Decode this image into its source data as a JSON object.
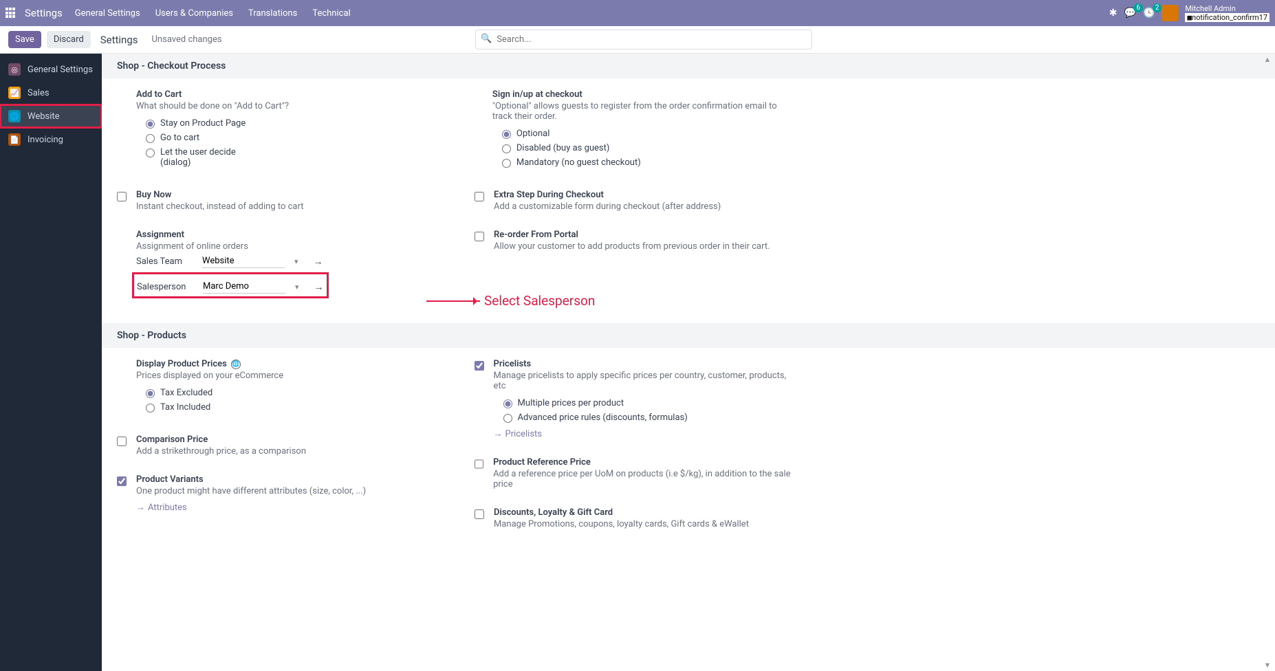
{
  "topbar": {
    "brand": "Settings",
    "menu": [
      "General Settings",
      "Users & Companies",
      "Translations",
      "Technical"
    ],
    "msg_badge": "6",
    "activity_badge": "2",
    "user_name": "Mitchell Admin",
    "notif_text": "notification_confirm17"
  },
  "actionbar": {
    "save": "Save",
    "discard": "Discard",
    "breadcrumb": "Settings",
    "status": "Unsaved changes",
    "search_placeholder": "Search..."
  },
  "sidebar": [
    {
      "label": "General Settings",
      "icon_bg": "#875A7B"
    },
    {
      "label": "Sales",
      "icon_bg": "#f97316"
    },
    {
      "label": "Website",
      "icon_bg": "#0ea5e9"
    },
    {
      "label": "Invoicing",
      "icon_bg": "#dc2626"
    }
  ],
  "sections": {
    "checkout": {
      "title": "Shop - Checkout Process",
      "add_to_cart": {
        "title": "Add to Cart",
        "desc": "What should be done on \"Add to Cart\"?",
        "opts": [
          "Stay on Product Page",
          "Go to cart",
          "Let the user decide (dialog)"
        ],
        "selected": 0
      },
      "sign_in": {
        "title": "Sign in/up at checkout",
        "desc": "\"Optional\" allows guests to register from the order confirmation email to track their order.",
        "opts": [
          "Optional",
          "Disabled (buy as guest)",
          "Mandatory (no guest checkout)"
        ],
        "selected": 0
      },
      "buy_now": {
        "title": "Buy Now",
        "desc": "Instant checkout, instead of adding to cart"
      },
      "extra_step": {
        "title": "Extra Step During Checkout",
        "desc": "Add a customizable form during checkout (after address)"
      },
      "assignment": {
        "title": "Assignment",
        "desc": "Assignment of online orders",
        "sales_team_label": "Sales Team",
        "sales_team_value": "Website",
        "salesperson_label": "Salesperson",
        "salesperson_value": "Marc Demo"
      },
      "reorder": {
        "title": "Re-order From Portal",
        "desc": "Allow your customer to add products from previous order in their cart."
      }
    },
    "products": {
      "title": "Shop - Products",
      "display_prices": {
        "title": "Display Product Prices",
        "desc": "Prices displayed on your eCommerce",
        "opts": [
          "Tax Excluded",
          "Tax Included"
        ],
        "selected": 0
      },
      "pricelists": {
        "title": "Pricelists",
        "desc": "Manage pricelists to apply specific prices per country, customer, products, etc",
        "opts": [
          "Multiple prices per product",
          "Advanced price rules (discounts, formulas)"
        ],
        "selected": 0,
        "link": "Pricelists"
      },
      "comparison": {
        "title": "Comparison Price",
        "desc": "Add a strikethrough price, as a comparison"
      },
      "ref_price": {
        "title": "Product Reference Price",
        "desc": "Add a reference price per UoM on products (i.e $/kg), in addition to the sale price"
      },
      "variants": {
        "title": "Product Variants",
        "desc": "One product might have different attributes (size, color, ...)",
        "link": "Attributes"
      },
      "discounts": {
        "title": "Discounts, Loyalty & Gift Card",
        "desc": "Manage Promotions, coupons, loyalty cards, Gift cards & eWallet"
      }
    }
  },
  "annotation_text": "Select Salesperson"
}
